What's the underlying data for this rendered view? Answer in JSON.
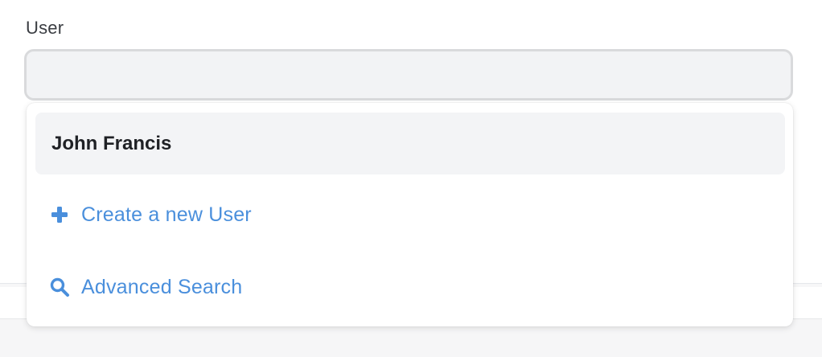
{
  "field": {
    "label": "User",
    "value": "",
    "placeholder": ""
  },
  "dropdown": {
    "options": [
      {
        "label": "John Francis"
      }
    ],
    "actions": {
      "create": {
        "label": "Create a new User",
        "icon": "plus-icon"
      },
      "search": {
        "label": "Advanced Search",
        "icon": "search-icon"
      }
    }
  },
  "colors": {
    "accent": "#4a8fdc",
    "input_bg": "#f2f3f5",
    "option_highlight": "#f3f4f6"
  }
}
